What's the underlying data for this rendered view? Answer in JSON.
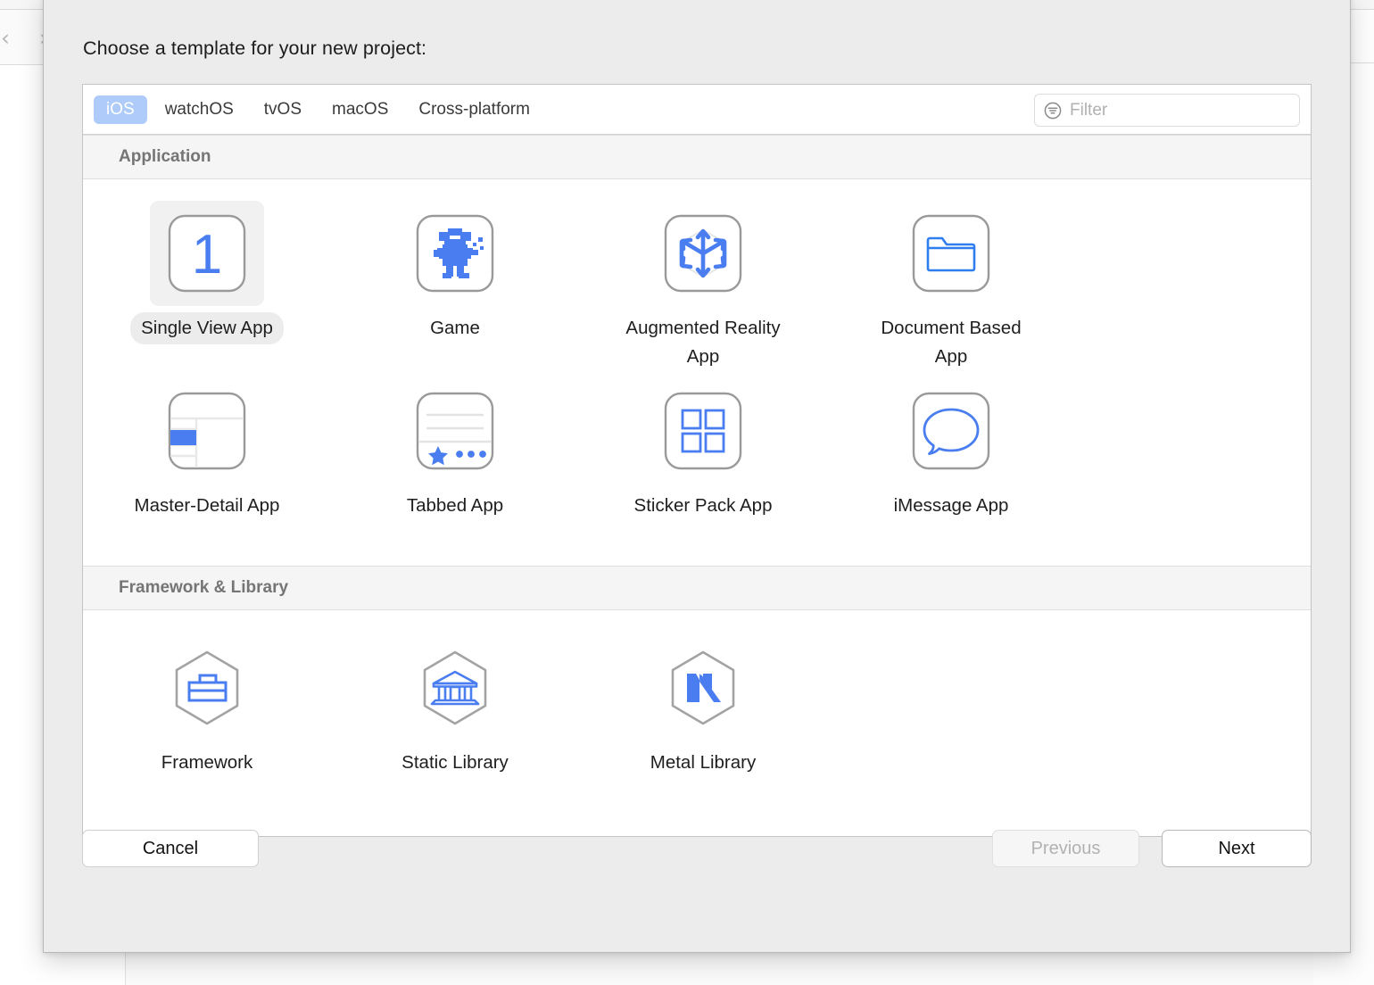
{
  "background": {
    "nav_back_icon": "chevron-left-icon",
    "nav_forward_icon": "chevron-right-icon"
  },
  "dialog": {
    "title": "Choose a template for your new project:",
    "platform_tabs": [
      {
        "label": "iOS",
        "selected": true
      },
      {
        "label": "watchOS",
        "selected": false
      },
      {
        "label": "tvOS",
        "selected": false
      },
      {
        "label": "macOS",
        "selected": false
      },
      {
        "label": "Cross-platform",
        "selected": false
      }
    ],
    "filter": {
      "placeholder": "Filter",
      "value": "",
      "icon": "filter-circle-icon"
    },
    "sections": [
      {
        "header": "Application",
        "templates": [
          {
            "label": "Single View App",
            "icon": "number-one-icon",
            "selected": true
          },
          {
            "label": "Game",
            "icon": "pixel-robot-icon",
            "selected": false
          },
          {
            "label": "Augmented Reality App",
            "icon": "ar-cube-icon",
            "selected": false
          },
          {
            "label": "Document Based App",
            "icon": "folder-icon",
            "selected": false
          },
          {
            "label": "Master-Detail App",
            "icon": "split-view-icon",
            "selected": false
          },
          {
            "label": "Tabbed App",
            "icon": "tab-bar-icon",
            "selected": false
          },
          {
            "label": "Sticker Pack App",
            "icon": "four-squares-grid-icon",
            "selected": false
          },
          {
            "label": "iMessage App",
            "icon": "speech-bubble-icon",
            "selected": false
          }
        ]
      },
      {
        "header": "Framework & Library",
        "templates": [
          {
            "label": "Framework",
            "icon": "toolbox-hexagon-icon",
            "selected": false
          },
          {
            "label": "Static Library",
            "icon": "building-hexagon-icon",
            "selected": false
          },
          {
            "label": "Metal Library",
            "icon": "metal-m-hexagon-icon",
            "selected": false
          }
        ]
      }
    ],
    "buttons": {
      "cancel": "Cancel",
      "previous": "Previous",
      "next": "Next"
    }
  },
  "colors": {
    "accent_blue": "#4a7ef0",
    "tab_selected_bg": "#aecbfa",
    "sheet_bg": "#ececec",
    "section_header_text": "#757575"
  }
}
